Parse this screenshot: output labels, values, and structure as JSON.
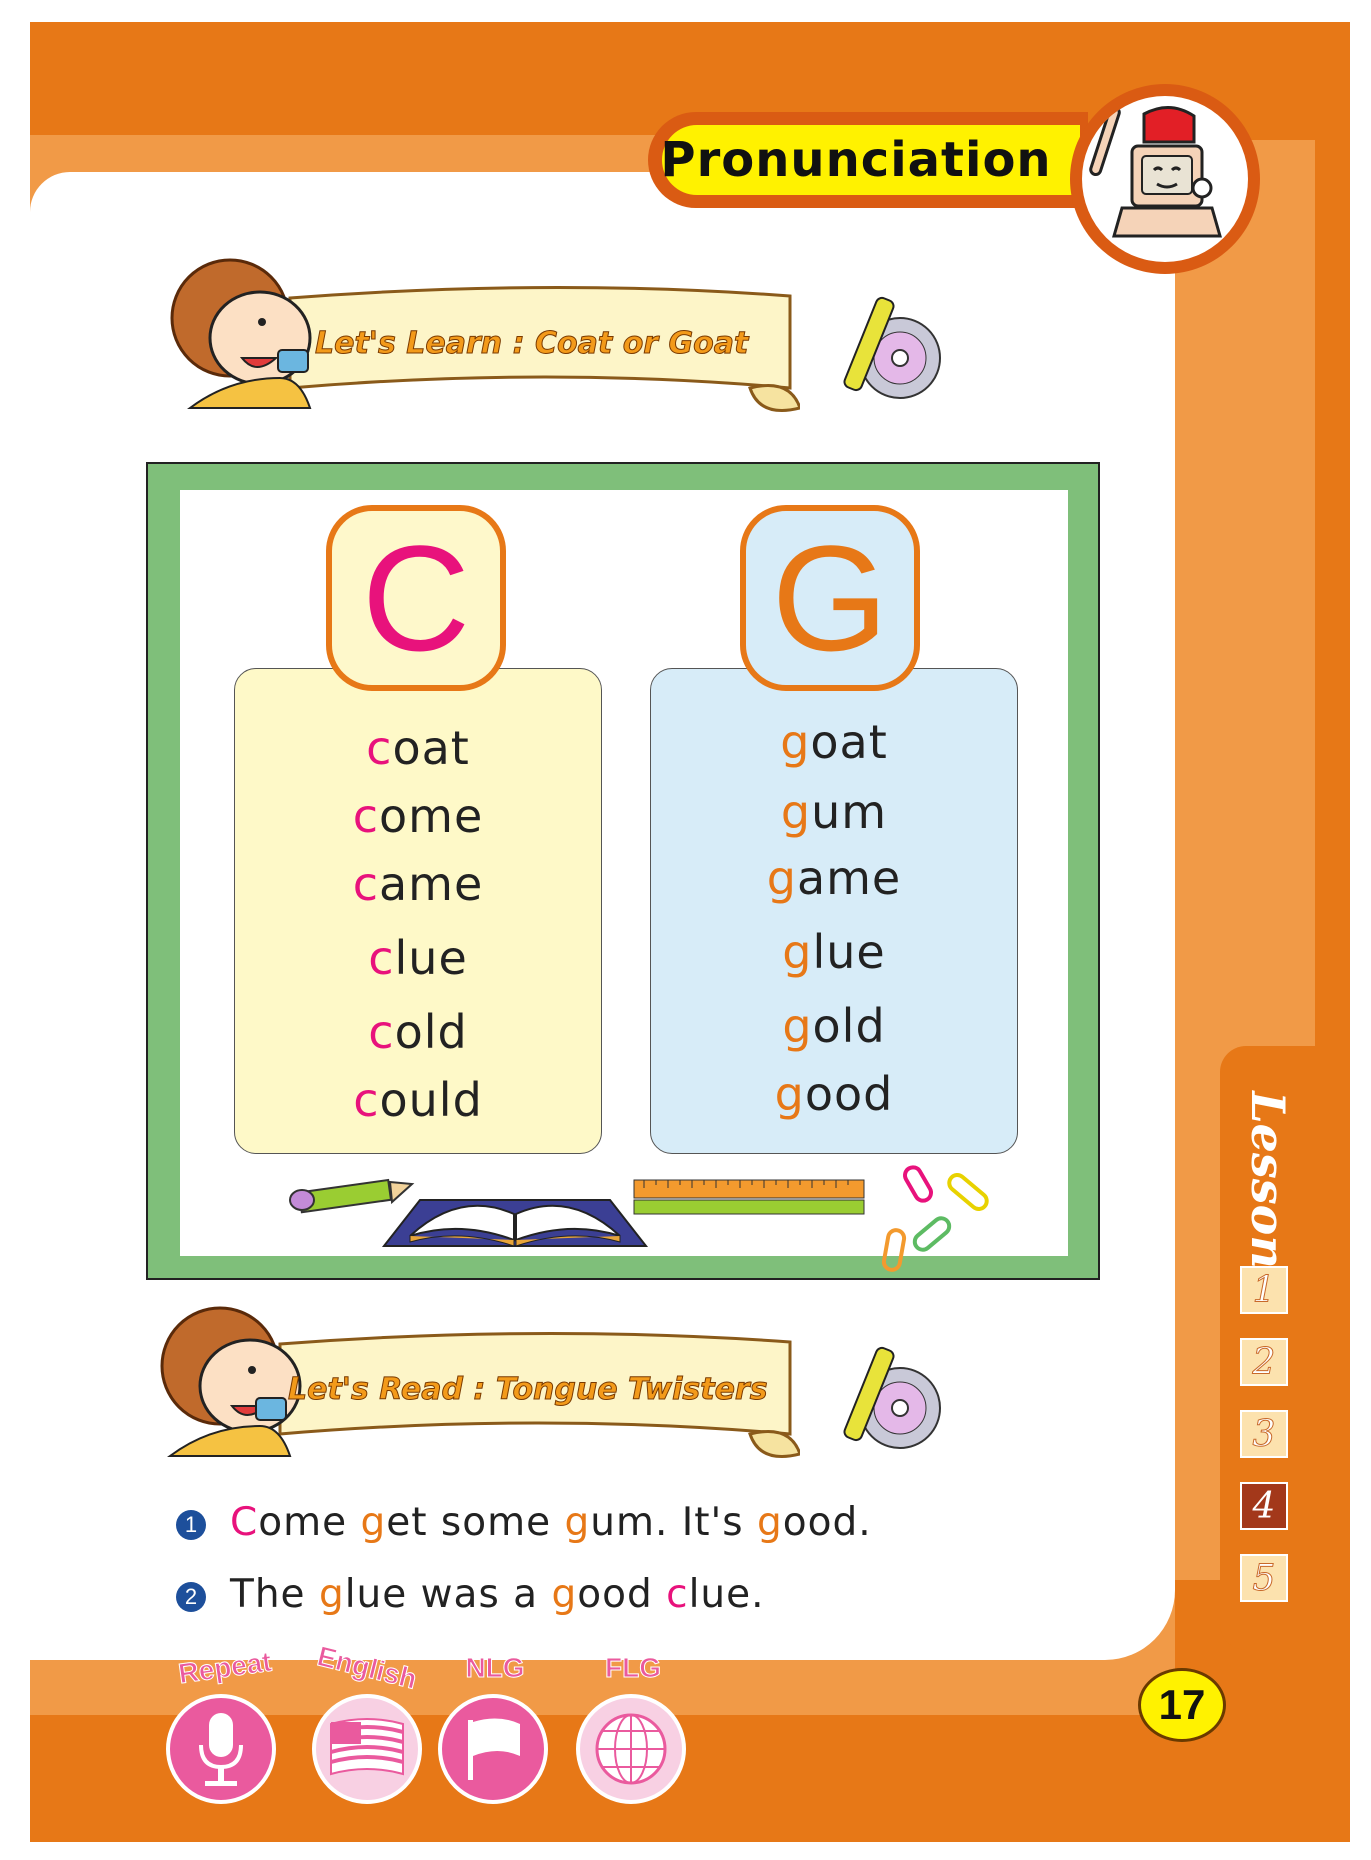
{
  "header": {
    "title": "Pronunciation"
  },
  "banners": {
    "learn": "Let's  Learn : Coat or Goat",
    "read": "Let's Read : Tongue Twisters"
  },
  "letters": {
    "c": "C",
    "g": "G"
  },
  "c_words": [
    {
      "first": "c",
      "rest": "oat"
    },
    {
      "first": "c",
      "rest": "ome"
    },
    {
      "first": "c",
      "rest": "ame"
    },
    {
      "first": "c",
      "rest": "lue"
    },
    {
      "first": "c",
      "rest": "old"
    },
    {
      "first": "c",
      "rest": "ould"
    }
  ],
  "g_words": [
    {
      "first": "g",
      "rest": "oat"
    },
    {
      "first": "g",
      "rest": "um"
    },
    {
      "first": "g",
      "rest": "ame"
    },
    {
      "first": "g",
      "rest": "lue"
    },
    {
      "first": "g",
      "rest": "old"
    },
    {
      "first": "g",
      "rest": "ood"
    }
  ],
  "tongue_twisters": [
    {
      "number": "1",
      "parts": [
        {
          "text": "C",
          "color": "#E8127C"
        },
        {
          "text": "ome ",
          "color": "#222222"
        },
        {
          "text": "g",
          "color": "#E77817"
        },
        {
          "text": "et some ",
          "color": "#222222"
        },
        {
          "text": "g",
          "color": "#E77817"
        },
        {
          "text": "um. It's ",
          "color": "#222222"
        },
        {
          "text": "g",
          "color": "#E77817"
        },
        {
          "text": "ood.",
          "color": "#222222"
        }
      ]
    },
    {
      "number": "2",
      "parts": [
        {
          "text": "The ",
          "color": "#222222"
        },
        {
          "text": "g",
          "color": "#E77817"
        },
        {
          "text": "lue was a ",
          "color": "#222222"
        },
        {
          "text": "g",
          "color": "#E77817"
        },
        {
          "text": "ood ",
          "color": "#222222"
        },
        {
          "text": "c",
          "color": "#E8127C"
        },
        {
          "text": "lue.",
          "color": "#222222"
        }
      ]
    }
  ],
  "lesson": {
    "label": "Lesson",
    "numbers": [
      "1",
      "2",
      "3",
      "4",
      "5"
    ],
    "active": "4"
  },
  "page_number": "17",
  "bottom_buttons": [
    {
      "label": "Repeat",
      "icon": "microphone-icon"
    },
    {
      "label": "English",
      "icon": "us-flag-icon"
    },
    {
      "label": "NLG",
      "icon": "flag-icon"
    },
    {
      "label": "FLG",
      "icon": "globe-icon"
    }
  ],
  "colors": {
    "orange": "#E77817",
    "light_orange": "#F19A47",
    "magenta": "#E8127C",
    "green_border": "#7FBF7A",
    "yellow_panel": "#FEF9C8",
    "blue_panel": "#D7ECF8",
    "header_yellow": "#FFF200",
    "pink_button": "#EA5A9E"
  }
}
